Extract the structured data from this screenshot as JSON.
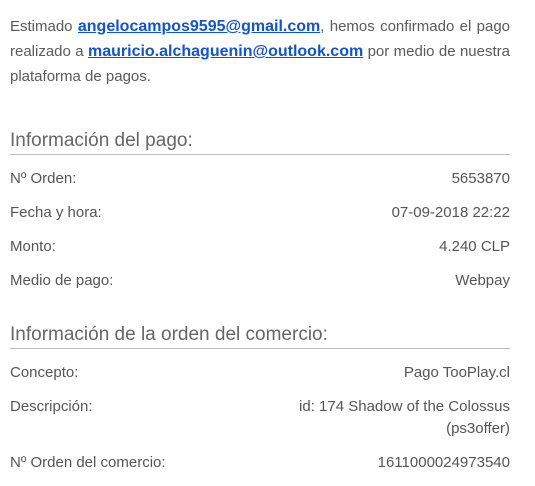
{
  "intro": {
    "greeting": "Estimado",
    "customer_email": "angelocampos9595@gmail.com",
    "text_confirmed": ", hemos confirmado el pago realizado a",
    "merchant_email": "mauricio.alchaguenin@outlook.com",
    "text_platform": "por medio de nuestra plataforma de pagos."
  },
  "payment_info": {
    "title": "Información del pago:",
    "rows": [
      {
        "label": "Nº Orden:",
        "value": "5653870"
      },
      {
        "label": "Fecha y hora:",
        "value": "07-09-2018 22:22"
      },
      {
        "label": "Monto:",
        "value": "4.240 CLP"
      },
      {
        "label": "Medio de pago:",
        "value": "Webpay"
      }
    ]
  },
  "order_info": {
    "title": "Información de la orden del comercio:",
    "rows": [
      {
        "label": "Concepto:",
        "value": "Pago TooPlay.cl"
      },
      {
        "label": "Descripción:",
        "value": "id: 174 Shadow of the Colossus (ps3offer)"
      },
      {
        "label": "Nº Orden del comercio:",
        "value": "1611000024973540"
      }
    ]
  }
}
